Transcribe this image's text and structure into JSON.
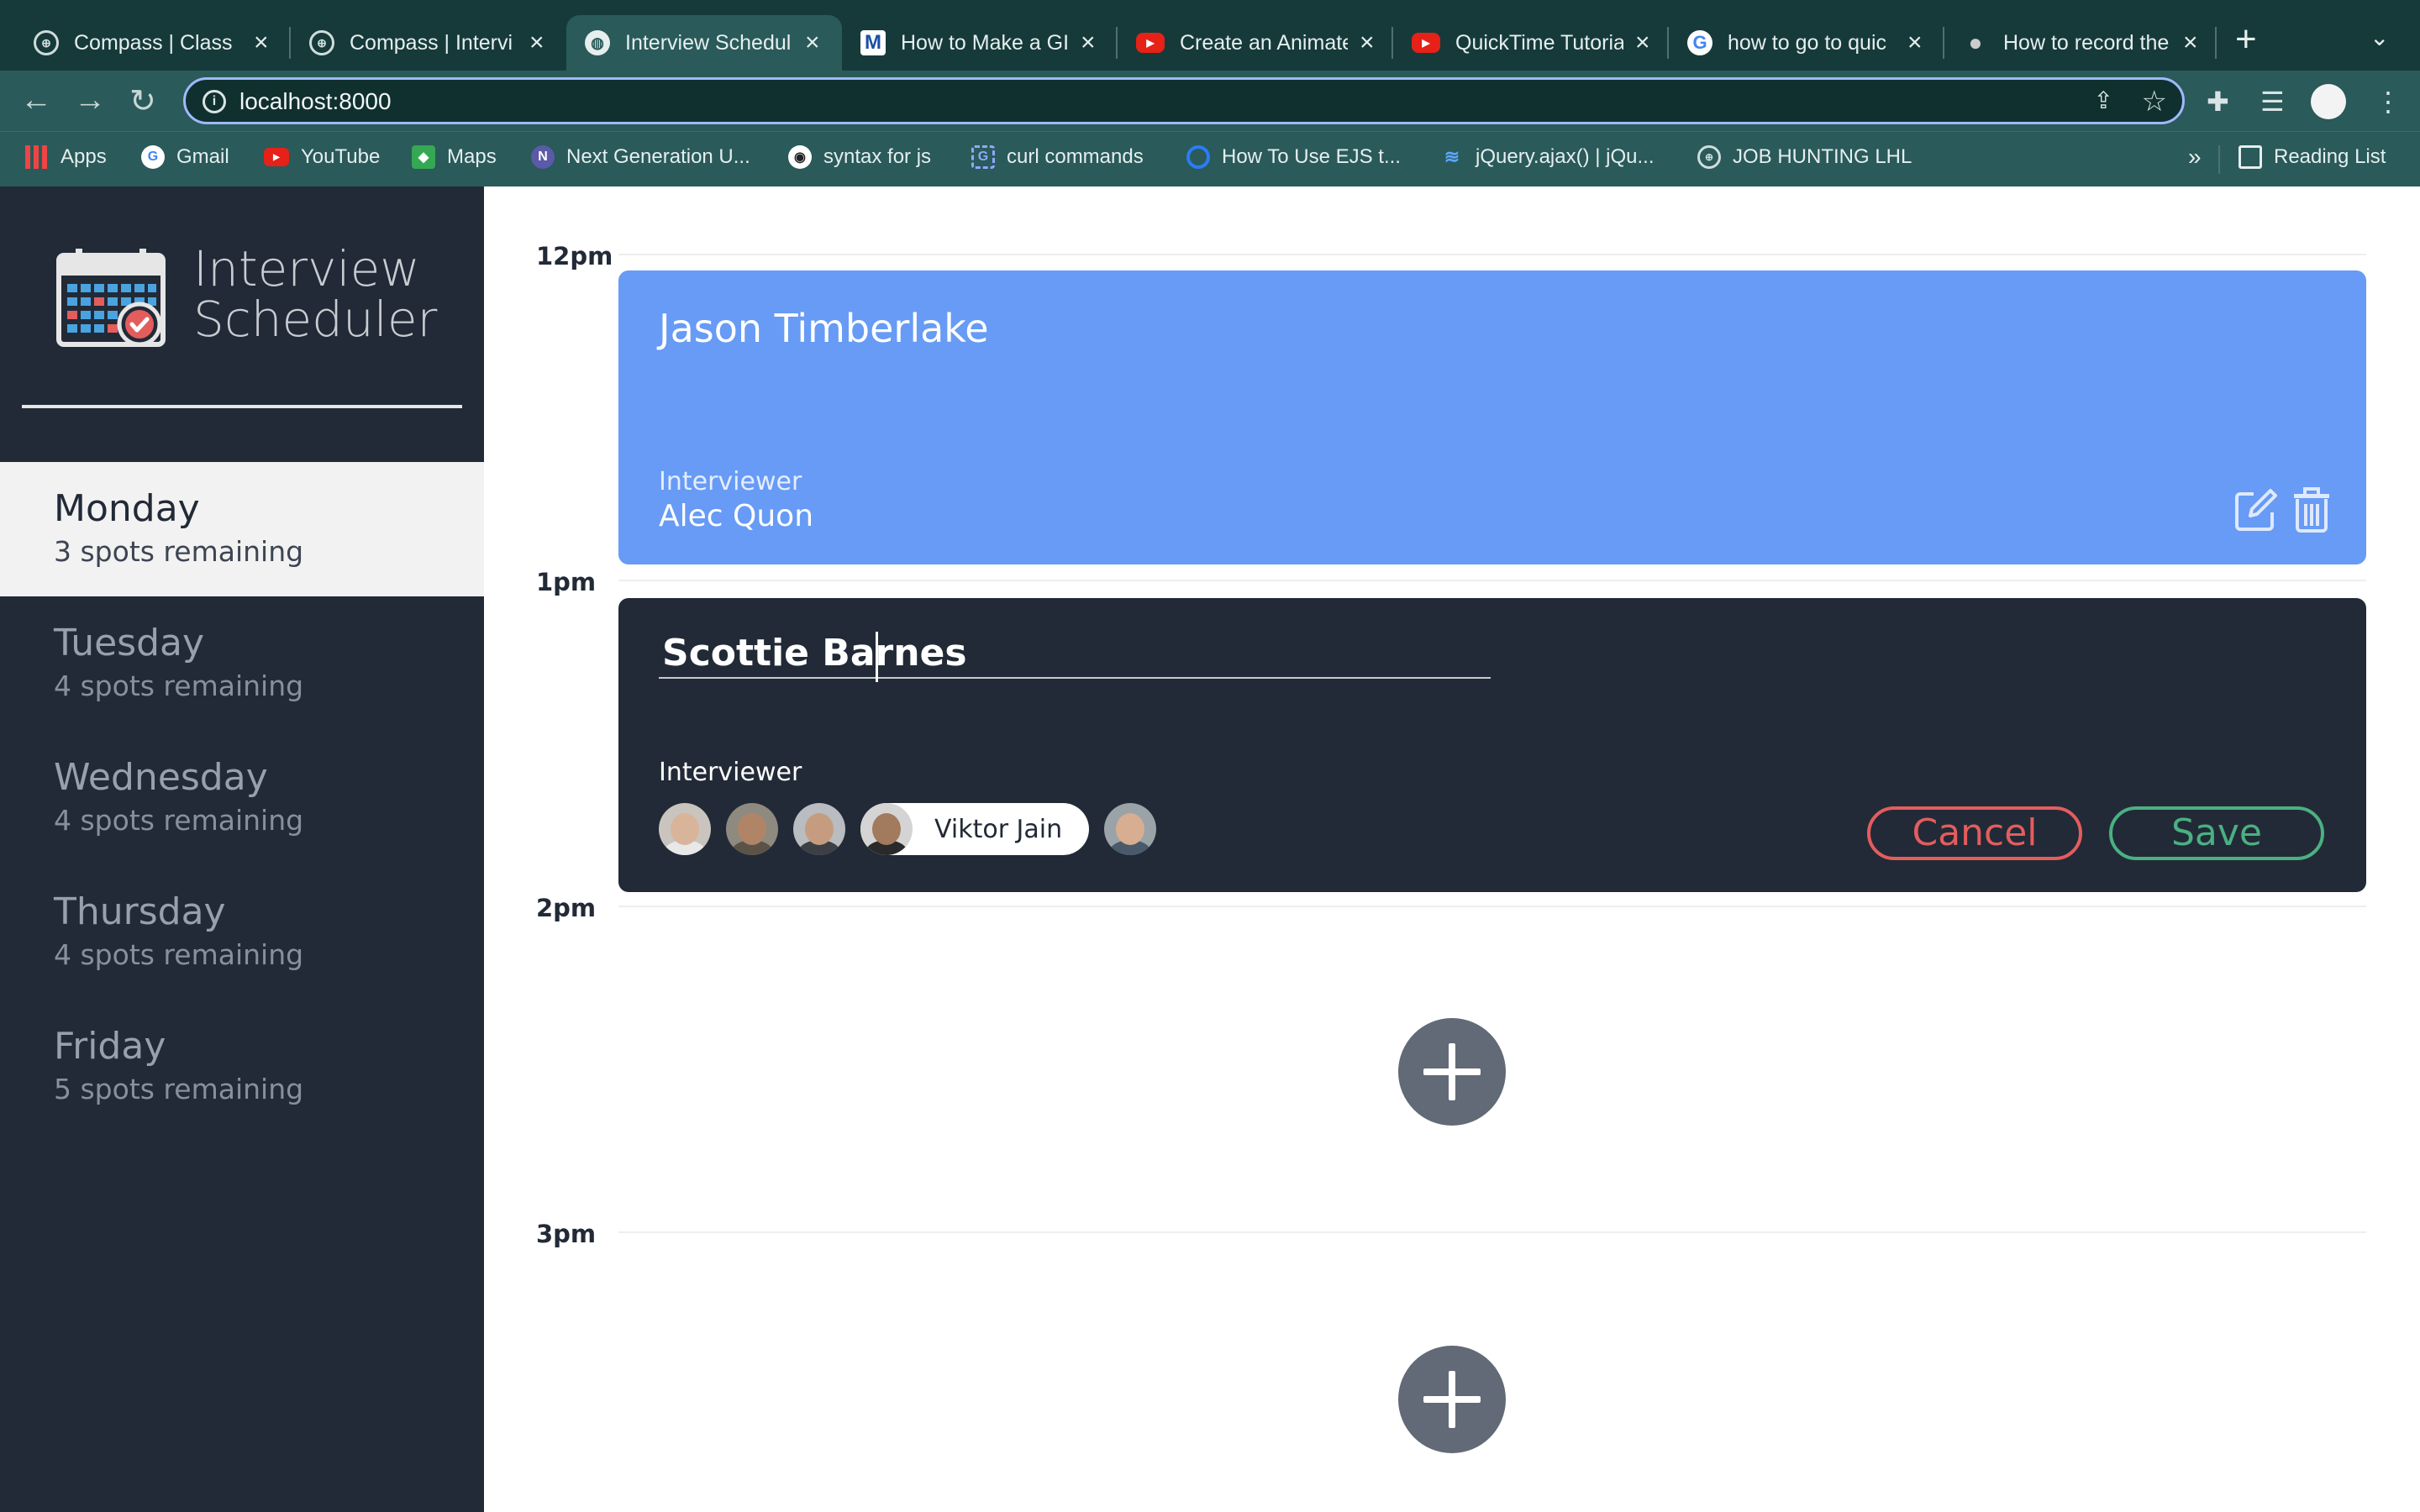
{
  "browser": {
    "tabs": [
      {
        "title": "Compass | Class",
        "icon": "compass-icon"
      },
      {
        "title": "Compass | Intervi",
        "icon": "compass-icon"
      },
      {
        "title": "Interview Schedul",
        "icon": "globe-icon",
        "active": true
      },
      {
        "title": "How to Make a GI",
        "icon": "medium-icon"
      },
      {
        "title": "Create an Animate",
        "icon": "youtube-icon"
      },
      {
        "title": "QuickTime Tutoria",
        "icon": "youtube-icon"
      },
      {
        "title": "how to go to quic",
        "icon": "google-icon"
      },
      {
        "title": "How to record the",
        "icon": "apple-icon"
      }
    ],
    "url": "localhost:8000",
    "bookmarks": [
      {
        "label": "Apps",
        "icon": "apps-grid-icon"
      },
      {
        "label": "Gmail",
        "icon": "google-icon"
      },
      {
        "label": "YouTube",
        "icon": "youtube-icon"
      },
      {
        "label": "Maps",
        "icon": "maps-icon"
      },
      {
        "label": "Next Generation U...",
        "icon": "nextgen-icon"
      },
      {
        "label": "syntax for js",
        "icon": "github-icon"
      },
      {
        "label": "curl commands",
        "icon": "curl-icon"
      },
      {
        "label": "How To Use EJS t...",
        "icon": "digitalocean-icon"
      },
      {
        "label": "jQuery.ajax() | jQu...",
        "icon": "jquery-icon"
      },
      {
        "label": "JOB HUNTING LHL",
        "icon": "compass-icon"
      }
    ],
    "bookmarks_more": "»",
    "reading_list": "Reading List"
  },
  "app": {
    "logo": {
      "line1": "Interview",
      "line2": "Scheduler"
    },
    "days": [
      {
        "name": "Monday",
        "spots": "3 spots remaining",
        "selected": true
      },
      {
        "name": "Tuesday",
        "spots": "4 spots remaining"
      },
      {
        "name": "Wednesday",
        "spots": "4 spots remaining"
      },
      {
        "name": "Thursday",
        "spots": "4 spots remaining"
      },
      {
        "name": "Friday",
        "spots": "5 spots remaining"
      }
    ],
    "times": [
      "12pm",
      "1pm",
      "2pm",
      "3pm"
    ],
    "appointment_show": {
      "student": "Jason Timberlake",
      "interviewer_label": "Interviewer",
      "interviewer": "Alec Quon"
    },
    "appointment_form": {
      "student_value": "Scottie Barnes",
      "interviewer_label": "Interviewer",
      "selected_interviewer": "Viktor Jain",
      "cancel_label": "Cancel",
      "save_label": "Save"
    },
    "colors": {
      "sidebar": "#222a37",
      "show_card": "#679bf5",
      "cancel": "#e35d5d",
      "save": "#4bb082",
      "add_button": "#616a76"
    }
  }
}
